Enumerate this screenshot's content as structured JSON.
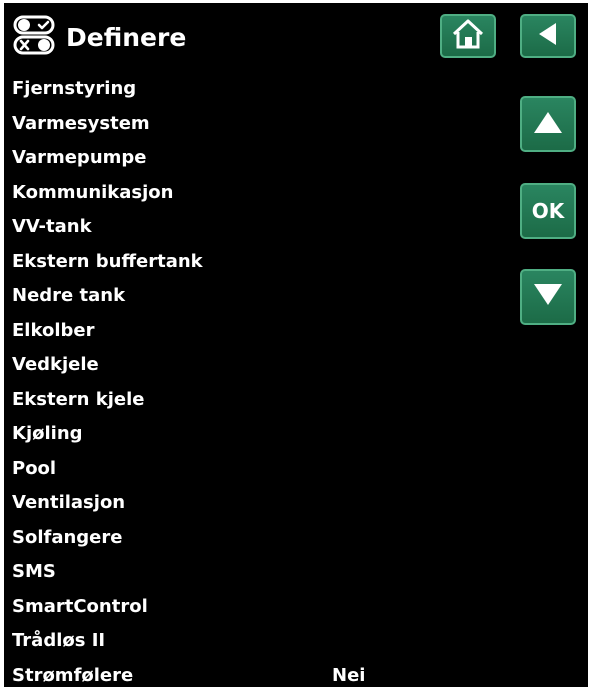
{
  "header": {
    "title": "Definere",
    "logo_icon": "settings-toggle-icon",
    "home_icon": "home-icon",
    "back_icon": "back-arrow-icon"
  },
  "nav": {
    "up_icon": "arrow-up-icon",
    "ok_label": "OK",
    "down_icon": "arrow-down-icon"
  },
  "colors": {
    "background": "#000000",
    "text": "#ffffff",
    "button": "#1f7450",
    "button_border": "#4fae83"
  },
  "menu": {
    "items": [
      {
        "label": "Fjernstyring"
      },
      {
        "label": "Varmesystem"
      },
      {
        "label": "Varmepumpe"
      },
      {
        "label": "Kommunikasjon"
      },
      {
        "label": "VV-tank"
      },
      {
        "label": "Ekstern buffertank"
      },
      {
        "label": "Nedre tank"
      },
      {
        "label": "Elkolber"
      },
      {
        "label": "Vedkjele"
      },
      {
        "label": "Ekstern kjele"
      },
      {
        "label": "Kjøling"
      },
      {
        "label": "Pool"
      },
      {
        "label": "Ventilasjon"
      },
      {
        "label": "Solfangere"
      },
      {
        "label": "SMS"
      },
      {
        "label": "SmartControl"
      },
      {
        "label": "Trådløs II"
      },
      {
        "label": "Strømfølere",
        "value": "Nei"
      }
    ]
  }
}
